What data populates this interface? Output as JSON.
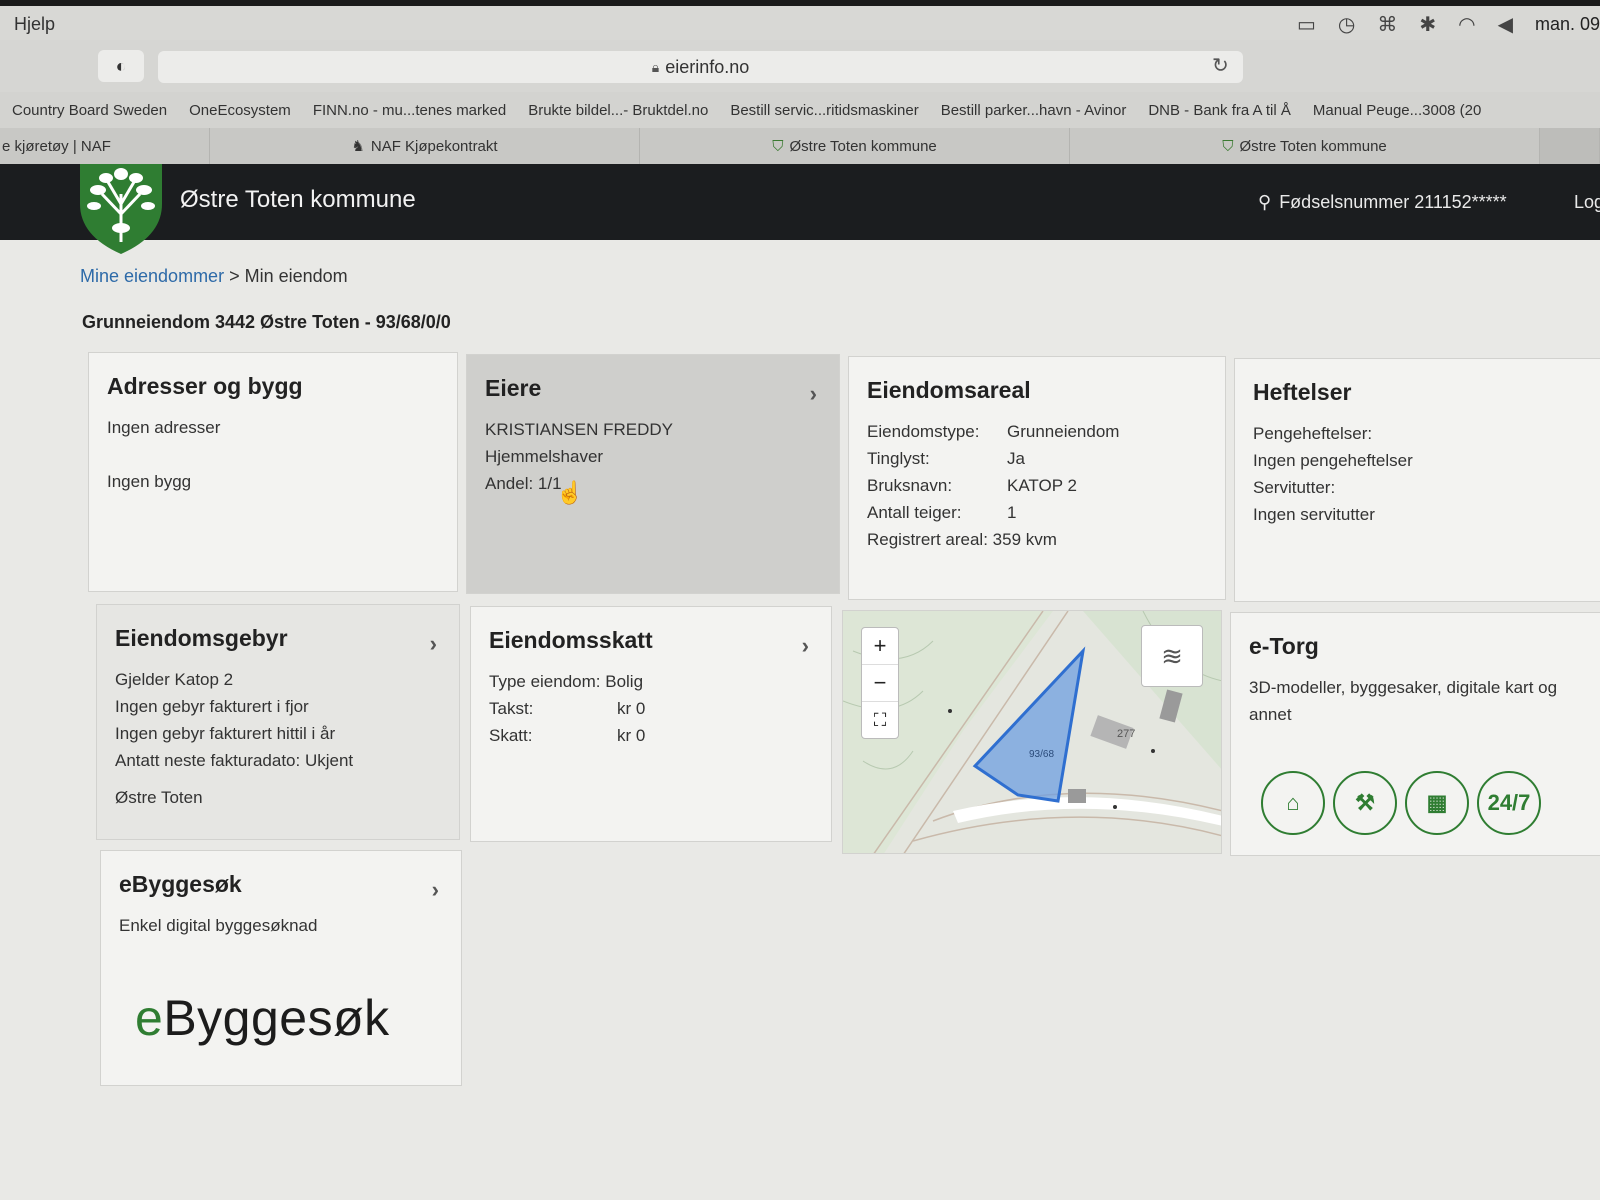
{
  "menubar": {
    "help": "Hjelp",
    "clock": "man. 09"
  },
  "toolbar": {
    "url": "eierinfo.no"
  },
  "bookmarks": [
    "Country Board Sweden",
    "OneEcosystem",
    "FINN.no - mu...tenes marked",
    "Brukte bildel...- Bruktdel.no",
    "Bestill servic...ritidsmaskiner",
    "Bestill parker...havn - Avinor",
    "DNB - Bank fra A til Å",
    "Manual Peuge...3008 (20"
  ],
  "tabs": [
    "e kjøretøy | NAF",
    "NAF Kjøpekontrakt",
    "Østre Toten kommune",
    "Østre Toten kommune"
  ],
  "header": {
    "site_title": "Østre Toten kommune",
    "user": "Fødselsnummer 211152*****",
    "logout": "Log"
  },
  "breadcrumb": {
    "parent": "Mine eiendommer",
    "sep": " > ",
    "current": "Min eiendom"
  },
  "property_title": "Grunneiendom 3442 Østre Toten - 93/68/0/0",
  "cards": {
    "adresser": {
      "title": "Adresser og bygg",
      "addresses": "Ingen adresser",
      "buildings": "Ingen bygg"
    },
    "eiere": {
      "title": "Eiere",
      "owner": "KRISTIANSEN FREDDY",
      "role": "Hjemmelshaver",
      "share": "Andel: 1/1"
    },
    "areal": {
      "title": "Eiendomsareal",
      "rows": [
        {
          "k": "Eiendomstype:",
          "v": "Grunneiendom"
        },
        {
          "k": "Tinglyst:",
          "v": "Ja"
        },
        {
          "k": "Bruksnavn:",
          "v": "KATOP 2"
        },
        {
          "k": "Antall teiger:",
          "v": "1"
        }
      ],
      "registered": "Registrert areal: 359 kvm"
    },
    "heftelser": {
      "title": "Heftelser",
      "l1": "Pengeheftelser:",
      "l2": "Ingen pengeheftelser",
      "l3": "Servitutter:",
      "l4": "Ingen servitutter"
    },
    "gebyr": {
      "title": "Eiendomsgebyr",
      "l1": "Gjelder Katop 2",
      "l2": "Ingen gebyr fakturert i fjor",
      "l3": "Ingen gebyr fakturert hittil i år",
      "l4": "Antatt neste fakturadato: Ukjent",
      "l5": "Østre Toten"
    },
    "skatt": {
      "title": "Eiendomsskatt",
      "type": "Type eiendom: Bolig",
      "rows": [
        {
          "k": "Takst:",
          "v": "kr 0"
        },
        {
          "k": "Skatt:",
          "v": "kr 0"
        }
      ]
    },
    "map": {
      "parcel_label": "93/68",
      "house_label": "277"
    },
    "etorg": {
      "title": "e-Torg",
      "text": "3D-modeller, byggesaker, digitale kart og annet",
      "icons": [
        "house-3d-icon",
        "hammer-icon",
        "map-icon"
      ],
      "icon247": "24/7"
    },
    "ebygg": {
      "title": "eByggesøk",
      "text": "Enkel digital byggesøknad",
      "logo_e": "e",
      "logo_rest": "Byggesøk"
    }
  },
  "colors": {
    "header_bg": "#1b1d1f",
    "accent_green": "#2f7d32",
    "link_blue": "#2d6aa8",
    "parcel_blue": "#2f6fd0"
  }
}
